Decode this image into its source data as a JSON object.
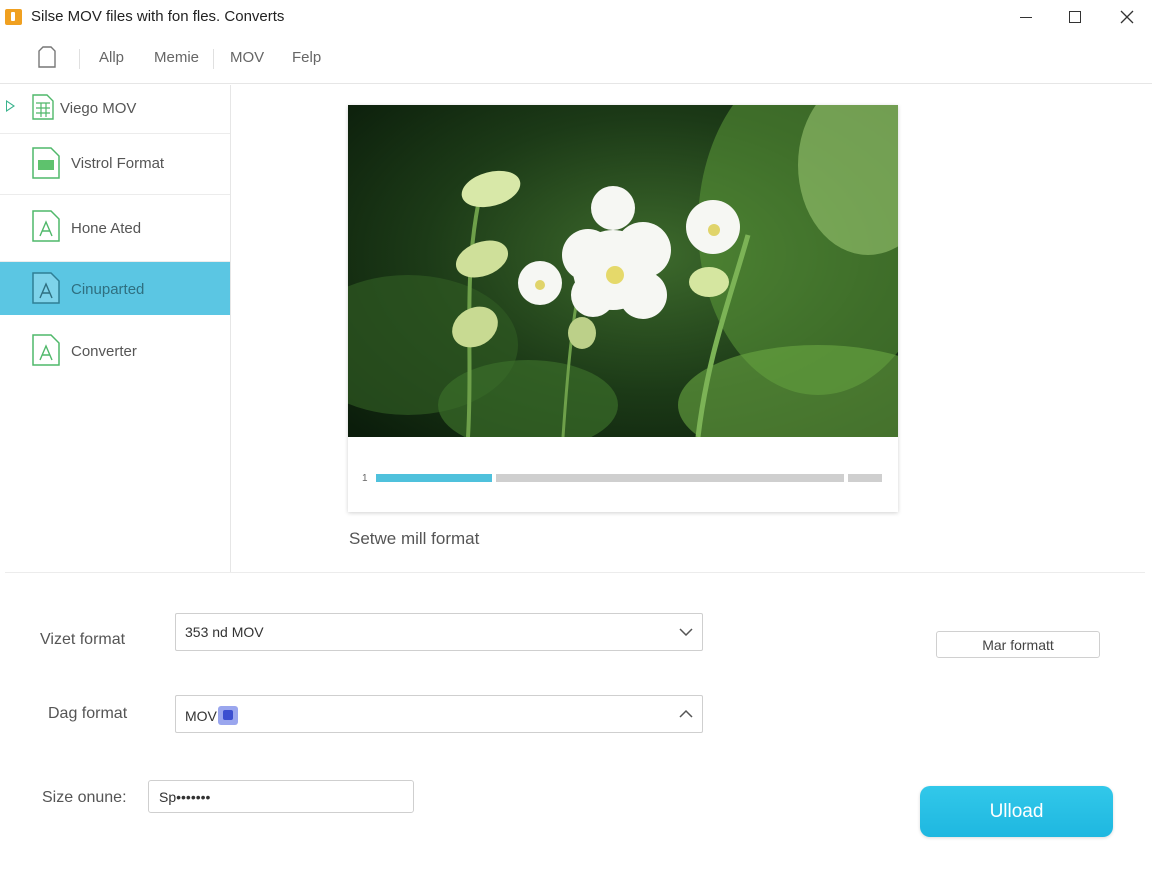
{
  "window": {
    "title": "Silse MOV files with fon fles. Converts",
    "controls": {
      "minimize_icon": "minimize-icon",
      "maximize_icon": "maximize-icon",
      "close_icon": "close-icon"
    }
  },
  "menubar": {
    "items": [
      "Allp",
      "Memie",
      "MOV",
      "Felp"
    ]
  },
  "sidebar": {
    "items": [
      {
        "label": "Viego MOV",
        "icon": "spreadsheet-icon",
        "expandable": true
      },
      {
        "label": "Vistrol Format",
        "icon": "document-icon"
      },
      {
        "label": "Hone Ated",
        "icon": "document-a-icon"
      },
      {
        "label": "Cinuparted",
        "icon": "document-a-icon",
        "selected": true
      },
      {
        "label": "Converter",
        "icon": "document-a-icon"
      }
    ]
  },
  "preview": {
    "progress_label": "1",
    "progress_percent": 23,
    "caption": "Setwe mill format"
  },
  "form": {
    "video_format": {
      "label": "Vizet format",
      "value": "353 nd MOV",
      "state": "collapsed"
    },
    "dag_format": {
      "label": "Dag format",
      "value": "MOV",
      "state": "expanded"
    },
    "size": {
      "label": "Size onune:",
      "value": "Sp•••••••"
    },
    "mar_button": "Mar formatt",
    "upload_button": "Ulload"
  },
  "colors": {
    "accent": "#5bc6e3",
    "upload": "#1eb7e0",
    "icon_green": "#4fb86a",
    "badge": "#3c4fd0"
  }
}
